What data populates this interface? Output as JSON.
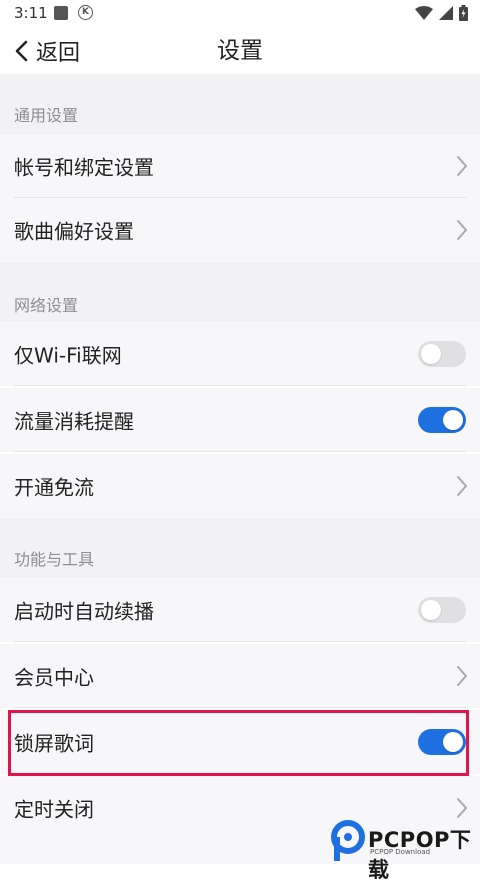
{
  "status_bar": {
    "time": "3:11",
    "k_glyph": "K"
  },
  "header": {
    "back_label": "返回",
    "title": "设置"
  },
  "sections": [
    {
      "label": "通用设置",
      "items": [
        {
          "label": "帐号和绑定设置",
          "control": "chevron"
        },
        {
          "label": "歌曲偏好设置",
          "control": "chevron"
        }
      ]
    },
    {
      "label": "网络设置",
      "items": [
        {
          "label": "仅Wi-Fi联网",
          "control": "toggle",
          "on": false
        },
        {
          "label": "流量消耗提醒",
          "control": "toggle",
          "on": true
        },
        {
          "label": "开通免流",
          "control": "chevron"
        }
      ]
    },
    {
      "label": "功能与工具",
      "items": [
        {
          "label": "启动时自动续播",
          "control": "toggle",
          "on": false
        },
        {
          "label": "会员中心",
          "control": "chevron"
        },
        {
          "label": "锁屏歌词",
          "control": "toggle",
          "on": true
        },
        {
          "label": "定时关闭",
          "control": "chevron"
        }
      ]
    }
  ],
  "watermark": {
    "brand": "PCPOP下载",
    "sub": "PCPOP Download"
  },
  "colors": {
    "accent": "#1e6fe0",
    "highlight": "#e0164a",
    "toggle_off": "#e0e0e2"
  }
}
